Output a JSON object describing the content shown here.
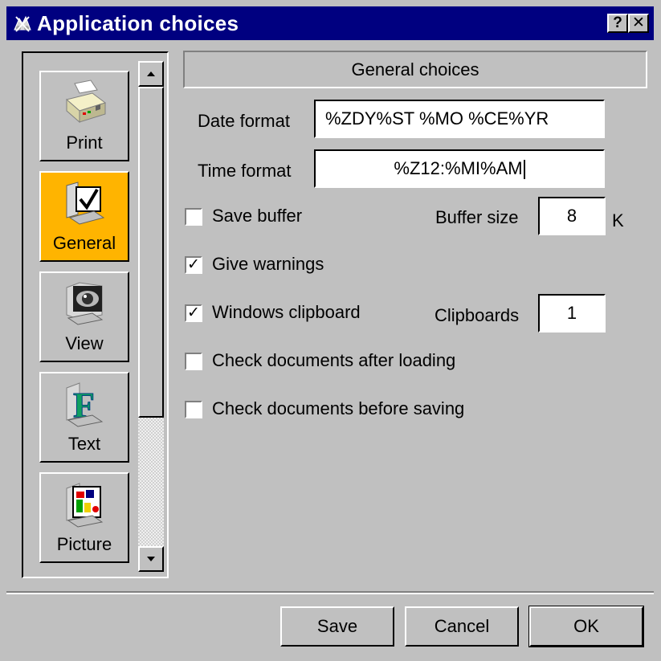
{
  "window": {
    "title": "Application choices",
    "help_label": "?",
    "close_label": "✕"
  },
  "tools": [
    {
      "label": "Print",
      "icon": "printer-icon",
      "active": false
    },
    {
      "label": "General",
      "icon": "checkbox-document-icon",
      "active": true
    },
    {
      "label": "View",
      "icon": "eye-icon",
      "active": false
    },
    {
      "label": "Text",
      "icon": "letter-f-icon",
      "active": false
    },
    {
      "label": "Picture",
      "icon": "picture-icon",
      "active": false
    }
  ],
  "scrollbar": {
    "up_label": "▲",
    "down_label": "▼"
  },
  "general": {
    "header": "General choices",
    "date_format_label": "Date format",
    "date_format_value": "%ZDY%ST %MO %CE%YR",
    "time_format_label": "Time format",
    "time_format_value": "%Z12:%MI%AM",
    "save_buffer_label": "Save buffer",
    "save_buffer_checked": false,
    "buffer_size_label": "Buffer size",
    "buffer_size_value": "8",
    "buffer_size_unit": "K",
    "give_warnings_label": "Give warnings",
    "give_warnings_checked": true,
    "windows_clipboard_label": "Windows clipboard",
    "windows_clipboard_checked": true,
    "clipboards_label": "Clipboards",
    "clipboards_value": "1",
    "check_after_loading_label": "Check documents after loading",
    "check_after_loading_checked": false,
    "check_before_saving_label": "Check documents before saving",
    "check_before_saving_checked": false,
    "check_mark": "✓"
  },
  "actions": {
    "save": "Save",
    "cancel": "Cancel",
    "ok": "OK"
  },
  "colors": {
    "title_bar": "#000080",
    "face": "#c0c0c0",
    "active_tool": "#ffb400"
  }
}
